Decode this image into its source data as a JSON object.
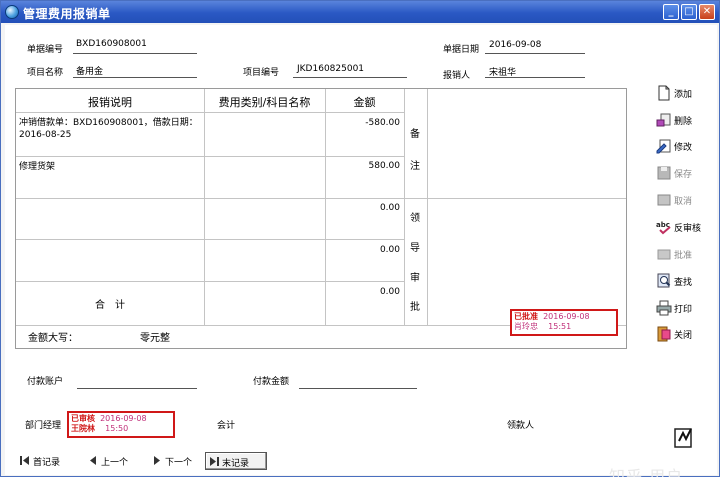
{
  "window": {
    "title": "管理费用报销单",
    "min": "_",
    "max": "□",
    "close": "✕"
  },
  "header": {
    "doc_no_label": "单据编号",
    "doc_no": "BXD160908001",
    "date_label": "单据日期",
    "date": "2016-09-08",
    "project_name_label": "项目名称",
    "project_name": "备用金",
    "project_no_label": "项目编号",
    "project_no": "JKD160825001",
    "claimant_label": "报销人",
    "claimant": "宋祖华"
  },
  "table": {
    "col_desc": "报销说明",
    "col_category": "费用类别/科目名称",
    "col_amount": "金额",
    "rows": [
      {
        "desc": "冲销借款单：BXD160908001，借款日期：2016-08-25",
        "category": "",
        "amount": "-580.00"
      },
      {
        "desc": "修理货架",
        "category": "",
        "amount": "580.00"
      },
      {
        "desc": "",
        "category": "",
        "amount": "0.00"
      },
      {
        "desc": "",
        "category": "",
        "amount": "0.00"
      },
      {
        "desc": "合　计",
        "category": "",
        "amount": "0.00"
      }
    ],
    "remark_chars": [
      "备",
      "注"
    ],
    "approval_chars": [
      "领",
      "导",
      "审",
      "批"
    ],
    "amount_words_label": "金额大写：",
    "amount_words": "零元整"
  },
  "approval_stamp": {
    "status": "已批准",
    "date": "2016-09-08",
    "user": "肖玲忠",
    "time": "15:51"
  },
  "footer": {
    "pay_account_label": "付款账户",
    "pay_account": "",
    "pay_amount_label": "付款金额",
    "pay_amount": "",
    "dept_manager_label": "部门经理",
    "accountant_label": "会计",
    "receiver_label": "领款人"
  },
  "audit_stamp": {
    "status": "已审核",
    "date": "2016-09-08",
    "user": "王院林",
    "time": "15:50"
  },
  "actions": {
    "add": "添加",
    "delete": "删除",
    "edit": "修改",
    "save": "保存",
    "cancel": "取消",
    "unaudit": "反审核",
    "approve": "批准",
    "find": "查找",
    "print": "打印",
    "close": "关闭"
  },
  "nav": {
    "first": "首记录",
    "prev": "上一个",
    "next": "下一个",
    "last": "末记录"
  },
  "watermark": "知乎 用户"
}
